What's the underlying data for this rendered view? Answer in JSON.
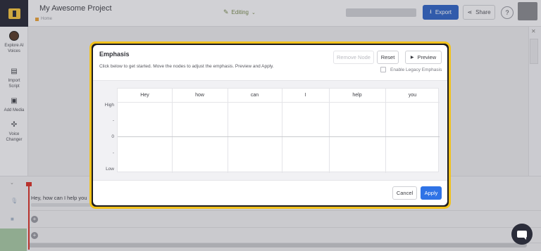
{
  "header": {
    "project_title": "My Awesome Project",
    "breadcrumb": "Home",
    "mode": "Editing",
    "export_label": "Export",
    "share_label": "Share",
    "help_label": "?"
  },
  "sidebar": {
    "items": [
      {
        "label": "Explore AI Voices"
      },
      {
        "label": "Import Script"
      },
      {
        "label": "Add Media"
      },
      {
        "label": "Voice Changer"
      }
    ]
  },
  "timeline": {
    "track_text": "Hey, how can I help you",
    "add_label": "+"
  },
  "modal": {
    "title": "Emphasis",
    "description": "Click below to get started. Move the nodes to adjust the emphasis. Preview and Apply.",
    "remove_node_label": "Remove Node",
    "reset_label": "Reset",
    "preview_label": "Preview",
    "legacy_label": "Enable Legacy Emphasis",
    "words": [
      "Hey",
      "how",
      "can",
      "I",
      "help",
      "you"
    ],
    "y_labels": {
      "high": "High",
      "dash1": "-",
      "zero": "0",
      "dash2": "-",
      "low": "Low"
    },
    "cancel_label": "Cancel",
    "apply_label": "Apply"
  },
  "icons": [
    "logo-icon",
    "pencil-icon",
    "chevron-down-icon",
    "export-icon",
    "share-icon",
    "help-icon",
    "mic-icon",
    "video-icon",
    "play-icon",
    "chat-icon"
  ],
  "colors": {
    "accent": "#2f73e6",
    "export": "#3467c6",
    "modal_border": "#f2c21b",
    "playhead": "#d8352c"
  }
}
